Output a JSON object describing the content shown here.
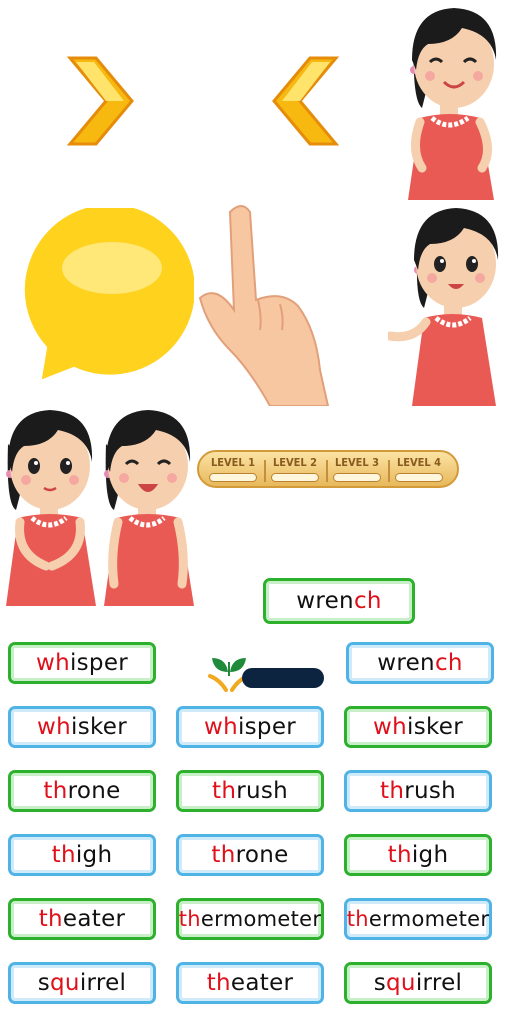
{
  "levels": [
    "LEVEL 1",
    "LEVEL 2",
    "LEVEL 3",
    "LEVEL 4"
  ],
  "target_word": {
    "pre": "wren",
    "hl": "ch",
    "post": ""
  },
  "words": [
    {
      "pre": "",
      "hl": "wh",
      "post": "isper",
      "style": "green"
    },
    {
      "pre": "wren",
      "hl": "ch",
      "post": "",
      "style": "blue"
    },
    {
      "pre": "",
      "hl": "wh",
      "post": "isker",
      "style": "blue"
    },
    {
      "pre": "",
      "hl": "wh",
      "post": "isper",
      "style": "blue"
    },
    {
      "pre": "",
      "hl": "wh",
      "post": "isker",
      "style": "green"
    },
    {
      "pre": "",
      "hl": "th",
      "post": "rone",
      "style": "green"
    },
    {
      "pre": "",
      "hl": "th",
      "post": "rush",
      "style": "green"
    },
    {
      "pre": "",
      "hl": "th",
      "post": "rush",
      "style": "blue"
    },
    {
      "pre": "",
      "hl": "th",
      "post": "igh",
      "style": "blue"
    },
    {
      "pre": "",
      "hl": "th",
      "post": "rone",
      "style": "blue"
    },
    {
      "pre": "",
      "hl": "th",
      "post": "igh",
      "style": "green"
    },
    {
      "pre": "",
      "hl": "th",
      "post": "eater",
      "style": "green"
    },
    {
      "pre": "",
      "hl": "th",
      "post": "ermometer",
      "style": "green"
    },
    {
      "pre": "",
      "hl": "th",
      "post": "ermometer",
      "style": "blue"
    },
    {
      "pre": "s",
      "hl": "qu",
      "post": "irrel",
      "style": "blue"
    },
    {
      "pre": "",
      "hl": "th",
      "post": "eater",
      "style": "blue"
    },
    {
      "pre": "s",
      "hl": "qu",
      "post": "irrel",
      "style": "green"
    }
  ],
  "progress_fraction": 0.0,
  "colors": {
    "green": "#2db12d",
    "blue": "#4fb3e6",
    "highlight": "#e0101a",
    "yellow": "#ffd21e"
  }
}
